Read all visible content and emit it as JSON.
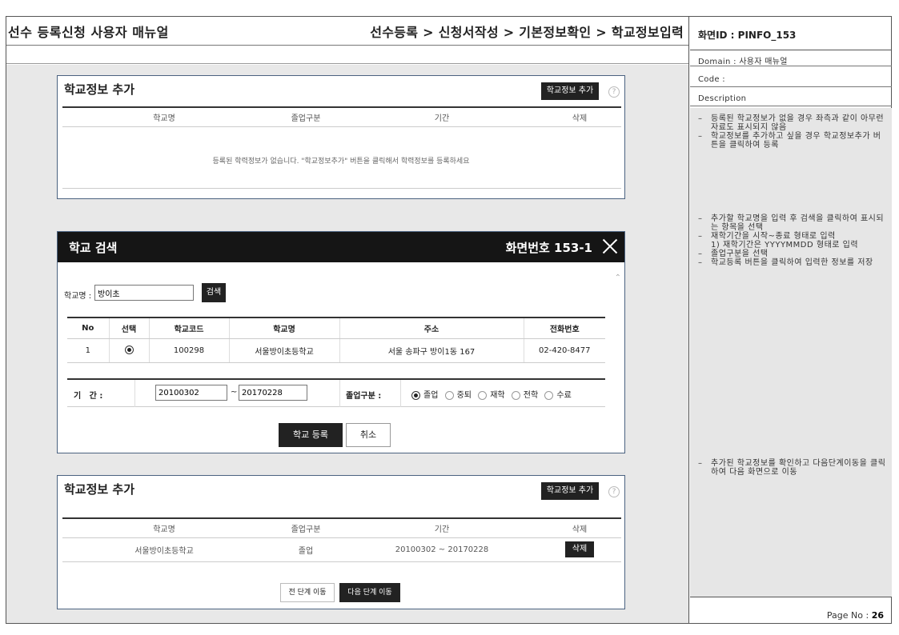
{
  "header": {
    "title": "선수 등록신청 사용자 매뉴얼",
    "breadcrumb": "선수등록 > 신청서작성 > 기본정보확인 > 학교정보입력"
  },
  "panel1": {
    "title": "학교정보 추가",
    "add_button": "학교정보 추가",
    "help": "?",
    "columns": [
      "학교명",
      "졸업구분",
      "기간",
      "삭제"
    ],
    "empty_message": "등록된 학력정보가 없습니다. \"학교정보추가\" 버튼을 클릭해서 학력정보를 등록하세요"
  },
  "modal": {
    "title": "학교 검색",
    "screen_no": "화면번호 153-1",
    "search_label": "학교명 :",
    "search_value": "방이초",
    "search_button": "검색",
    "columns": [
      "No",
      "선택",
      "학교코드",
      "학교명",
      "주소",
      "전화번호"
    ],
    "rows": [
      {
        "no": "1",
        "code": "100298",
        "name": "서울방이초등학교",
        "address": "서울 송파구 방이1동 167",
        "phone": "02-420-8477"
      }
    ],
    "period_label": "기   간 :",
    "period_start": "20100302",
    "period_sep": "~",
    "period_end": "20170228",
    "grad_label": "졸업구분 :",
    "grad_options": [
      "졸업",
      "중퇴",
      "재학",
      "전학",
      "수료"
    ],
    "register_button": "학교 등록",
    "cancel_button": "취소"
  },
  "panel2": {
    "title": "학교정보 추가",
    "add_button": "학교정보 추가",
    "help": "?",
    "columns": [
      "학교명",
      "졸업구분",
      "기간",
      "삭제"
    ],
    "row": {
      "name": "서울방이초등학교",
      "grad": "졸업",
      "period": "20100302 ~ 20170228",
      "delete": "삭제"
    },
    "prev_button": "전 단계 이동",
    "next_button": "다음 단계 이동"
  },
  "side": {
    "screen_id": "화면ID : PINFO_153",
    "domain": "Domain : 사용자 매뉴얼",
    "code": "Code :",
    "description": "Description",
    "note1": [
      "등록된 학교정보가 없을 경우 좌측과 같이 아무런 자료도 표시되지 않음",
      "학교정보를 추가하고 싶을 경우 학교정보추가 버튼을 클릭하여 등록"
    ],
    "note2": [
      "추가할 학교명을 입력 후 검색을 클릭하여 표시되는 항목을 선택",
      "재학기간을 시작~종료 형태로 입력",
      "1) 재학기간은 YYYYMMDD 형태로 입력",
      "졸업구분을 선택",
      "학교등록 버튼을 클릭하여 입력한 정보를 저장"
    ],
    "note3": [
      "추가된 학교정보를 확인하고 다음단계이동을 클릭하여 다음 화면으로 이동"
    ],
    "page_label": "Page No :",
    "page_number": "26"
  }
}
